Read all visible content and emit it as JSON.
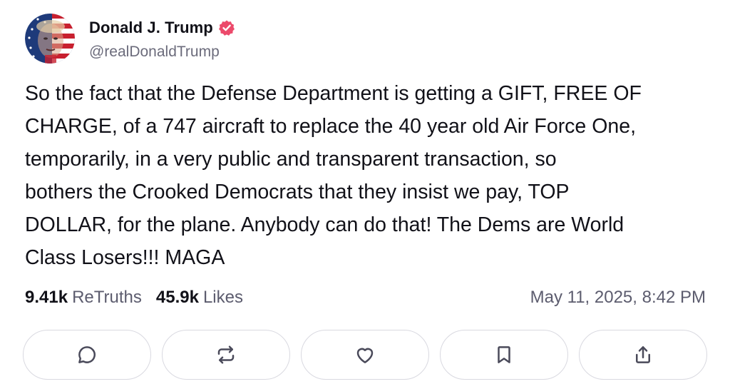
{
  "author": {
    "display_name": "Donald J. Trump",
    "handle": "@realDonaldTrump",
    "verified": true,
    "verified_color": "#ec4a6b",
    "avatar_icon": "avatar-flag-portrait"
  },
  "post": {
    "text": "So the fact that the Defense Department is getting a GIFT, FREE OF\nCHARGE, of a 747 aircraft to replace the 40 year old Air Force One,\ntemporarily, in a very public and transparent transaction, so\nbothers the Crooked Democrats that they insist we pay, TOP\nDOLLAR, for the plane. Anybody can do that! The Dems are World\nClass Losers!!! MAGA",
    "timestamp": "May 11, 2025, 8:42 PM"
  },
  "stats": {
    "retruths_count": "9.41k",
    "retruths_label": "ReTruths",
    "likes_count": "45.9k",
    "likes_label": "Likes"
  },
  "actions": [
    {
      "icon": "comment-icon"
    },
    {
      "icon": "retruth-icon"
    },
    {
      "icon": "heart-icon"
    },
    {
      "icon": "bookmark-icon"
    },
    {
      "icon": "share-icon"
    }
  ],
  "colors": {
    "text": "#111118",
    "muted": "#5c5c6e",
    "border": "#d9d9e0",
    "accent": "#ec4a6b"
  }
}
